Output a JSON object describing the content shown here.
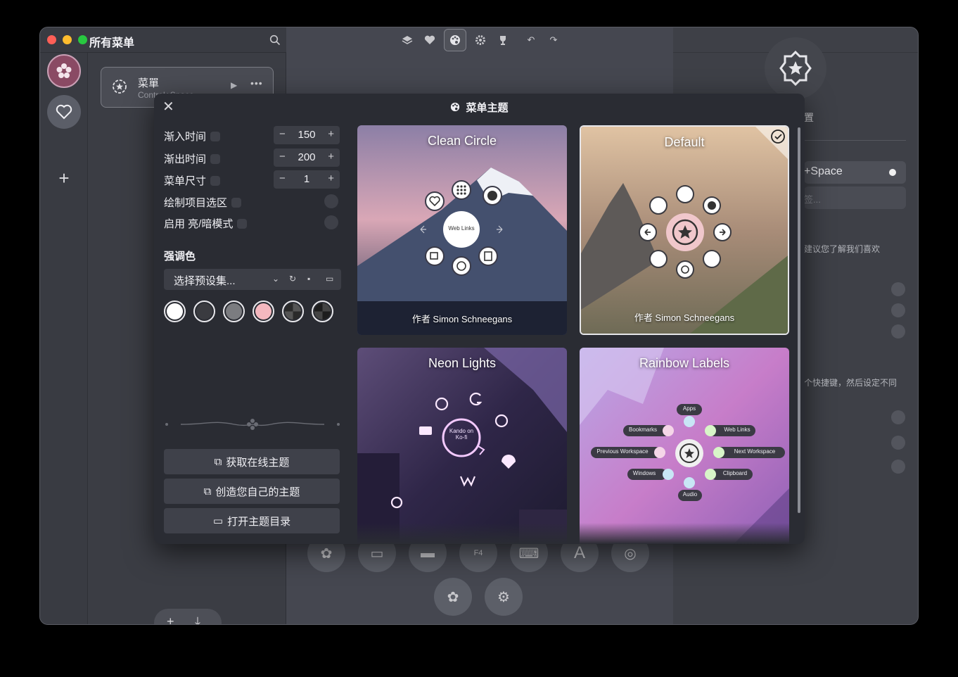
{
  "app": {
    "title": "所有菜单",
    "icons": {
      "search": "search-icon"
    }
  },
  "sidebar": {
    "items": [
      {
        "icon": "flower-icon",
        "active": true
      },
      {
        "icon": "heart-icon",
        "active": false
      },
      {
        "icon": "plus-icon",
        "active": false
      }
    ]
  },
  "menu_list": {
    "items": [
      {
        "name": "菜單",
        "shortcut": "Control+Space",
        "icon": "gear-star-icon"
      }
    ]
  },
  "toolbar": {
    "buttons": [
      {
        "icon": "layers-icon"
      },
      {
        "icon": "heart-icon"
      },
      {
        "icon": "palette-icon",
        "active": true
      },
      {
        "icon": "gear-icon"
      },
      {
        "icon": "trophy-icon"
      },
      {
        "icon": "undo-icon"
      },
      {
        "icon": "redo-icon"
      }
    ]
  },
  "right_panel": {
    "title_fragment": "置",
    "shortcut": "+Space",
    "tag_placeholder": "签...",
    "note1": "建议您了解我们喜欢",
    "note2": "个快捷键，然后设定不同"
  },
  "dialog": {
    "title": "菜单主题",
    "settings": {
      "fade_in": {
        "label": "渐入时间",
        "value": "150"
      },
      "fade_out": {
        "label": "渐出时间",
        "value": "200"
      },
      "menu_size": {
        "label": "菜单尺寸",
        "value": "1"
      },
      "draw_selection": {
        "label": "绘制项目选区"
      },
      "dark_mode": {
        "label": "启用 亮/暗模式"
      }
    },
    "accent": {
      "heading": "强调色",
      "preset_placeholder": "选择预设集...",
      "swatches": [
        "#ffffff",
        "#3a3b40",
        "#7b7c80",
        "#f4b8bf",
        "checker",
        "checker-dark"
      ]
    },
    "buttons": {
      "get_online": "获取在线主题",
      "create_own": "创造您自己的主题",
      "open_dir": "打开主题目录"
    },
    "themes": [
      {
        "name": "Clean Circle",
        "author": "作者 Simon Schneegans",
        "center_label": "Web Links",
        "selected": false
      },
      {
        "name": "Default",
        "author": "作者 Simon Schneegans",
        "selected": true
      },
      {
        "name": "Neon Lights",
        "center_label": "Kando on Ko-fi",
        "selected": false
      },
      {
        "name": "Rainbow Labels",
        "center_label": "",
        "labels": [
          "Apps",
          "Bookmarks",
          "Web Links",
          "Previous Workspace",
          "Next Workspace",
          "Windows",
          "Clipboard",
          "Audio"
        ],
        "selected": false
      }
    ]
  }
}
